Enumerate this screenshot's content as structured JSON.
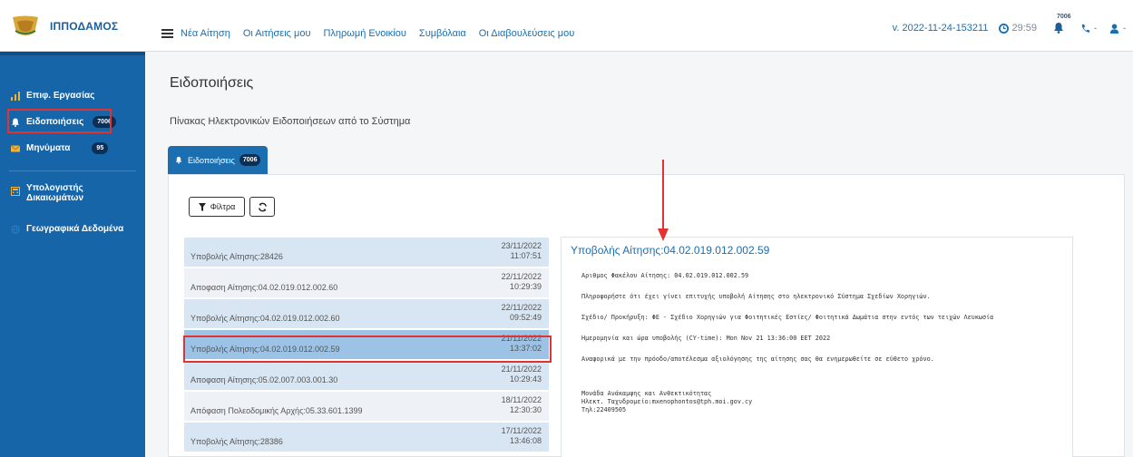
{
  "app": {
    "brand": "ΙΠΠΟΔΑΜΟΣ",
    "nav": [
      "Νέα Αίτηση",
      "Οι Αιτήσεις μου",
      "Πληρωμή Ενοικίου",
      "Συμβόλαια",
      "Οι Διαβουλεύσεις μου"
    ],
    "version": "v. 2022-11-24-153211",
    "timer": "29:59",
    "bell_count": "7006",
    "caret": "-"
  },
  "sidebar": {
    "items": [
      {
        "label": "Επιφ. Εργασίας",
        "icon": "bar-chart-icon"
      },
      {
        "label": "Ειδοποιήσεις",
        "badge": "7006",
        "icon": "bell-icon"
      },
      {
        "label": "Μηνύματα",
        "badge": "95",
        "icon": "envelope-icon"
      },
      {
        "label": "Υπολογιστής Δικαιωμάτων",
        "icon": "calculator-icon"
      },
      {
        "label": "Γεωγραφικά Δεδομένα",
        "icon": "globe-icon"
      }
    ]
  },
  "main": {
    "title": "Ειδοποιήσεις",
    "subtitle": "Πίνακας Ηλεκτρονικών Ειδοποιήσεων από το Σύστημα",
    "tab": {
      "label": "Ειδοποιήσεις",
      "badge": "7006"
    },
    "filter_label": "Φίλτρα"
  },
  "notifications": [
    {
      "title": "Υποβολής Αίτησης:28426",
      "date": "23/11/2022",
      "time": "11:07:51"
    },
    {
      "title": "Αποφαση Αίτησης:04.02.019.012.002.60",
      "date": "22/11/2022",
      "time": "10:29:39"
    },
    {
      "title": "Υποβολής Αίτησης:04.02.019.012.002.60",
      "date": "22/11/2022",
      "time": "09:52:49"
    },
    {
      "title": "Υποβολής Αίτησης:04.02.019.012.002.59",
      "date": "21/11/2022",
      "time": "13:37:02"
    },
    {
      "title": "Αποφαση Αίτησης:05.02.007.003.001.30",
      "date": "21/11/2022",
      "time": "10:29:43"
    },
    {
      "title": "Απόφαση Πολεοδομικής Αρχής:05.33.601.1399",
      "date": "18/11/2022",
      "time": "12:30:30"
    },
    {
      "title": "Υποβολής Αίτησης:28386",
      "date": "17/11/2022",
      "time": "13:46:08"
    }
  ],
  "detail": {
    "title": "Υποβολής Αίτησης:04.02.019.012.002.59",
    "lines": [
      "Αριθμος Φακέλου Αίτησης: 04.02.019.012.002.59",
      "Πληροφορήστε ότι έχει γίνει επιτυχής υποβολή Αίτησης στο ηλεκτρονικό Σύστημα Σχεδίων Χορηγιών.",
      "Σχέδιο/ Προκήρυξη: ΦΕ - Σχέδιο Χορηγιών για Φοιτητικές Εστίες/ Φοιτητικά Δωμάτια στην εντός των τειχών Λευκωσία",
      "Ημερομηνία και ώρα υποβολής (CY-time): Mon Nov 21 13:36:00 EET 2022",
      "Αναφορικά με την πρόοδο/αποτέλεσμα αξιολόγησης της αίτησης σας θα ενημερωθείτε σε εύθετο χρόνο.",
      "Μονάδα Ανάκαμψης και Ανθεκτικότητας",
      "Ηλεκτ. Ταχυδρομείο:mxenophontos@tph.moi.gov.cy",
      "Τηλ:22409505"
    ]
  },
  "colors": {
    "primary": "#1565a8",
    "accent": "#1b6fb0",
    "highlight": "#e03434"
  }
}
